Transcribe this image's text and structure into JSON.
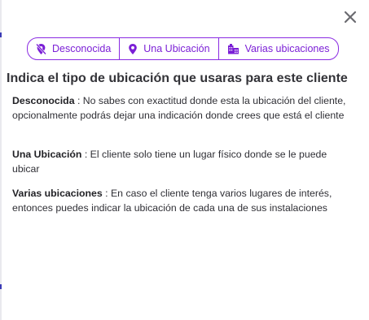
{
  "dialog": {
    "close_icon": "close-icon",
    "location_types": [
      {
        "label": "Desconocida",
        "icon": "location-off-icon"
      },
      {
        "label": "Una Ubicación",
        "icon": "location-pin-icon"
      },
      {
        "label": "Varias ubicaciones",
        "icon": "buildings-icon"
      }
    ],
    "title": "Indica el tipo de ubicación que usaras para este cliente",
    "descriptions": [
      {
        "term": "Desconocida",
        "separator": " : ",
        "text": "No sabes con exactitud donde esta la ubicación del cliente, opcionalmente podrás dejar una indicación donde crees que está el cliente"
      },
      {
        "term": "Una Ubicación",
        "separator": " : ",
        "text": "El cliente solo tiene un lugar físico donde se le puede ubicar"
      },
      {
        "term": "Varias ubicaciones",
        "separator": " : ",
        "text": "En caso el cliente tenga varios lugares de interés, entonces puedes indicar la ubicación de cada una de sus instalaciones"
      }
    ]
  },
  "colors": {
    "accent": "#8a2be2",
    "accent_text": "#7b1fd6",
    "title_text": "#333338",
    "body_text": "#2f2f35",
    "close_icon": "#6b6b70"
  }
}
